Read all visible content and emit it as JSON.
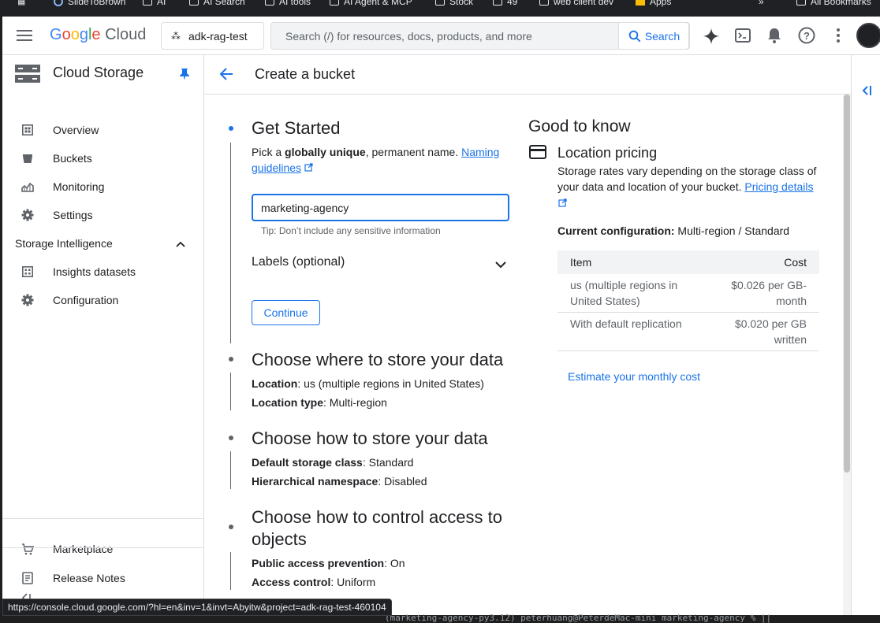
{
  "bookmarks": [
    "SlideToBrown",
    "AI",
    "AI Search",
    "AI tools",
    "AI Agent & MCP",
    "Stock",
    "49",
    "web client dev",
    "Apps",
    "All Bookmarks"
  ],
  "header": {
    "logo_google": "Google",
    "logo_cloud": "Cloud",
    "project": "adk-rag-test",
    "search_placeholder": "Search (/) for resources, docs, products, and more",
    "search_button": "Search"
  },
  "sidebar": {
    "title": "Cloud Storage",
    "items": [
      {
        "label": "Overview",
        "icon": "dashboard-icon"
      },
      {
        "label": "Buckets",
        "icon": "bucket-icon"
      },
      {
        "label": "Monitoring",
        "icon": "monitoring-icon"
      },
      {
        "label": "Settings",
        "icon": "gear-icon"
      }
    ],
    "section": "Storage Intelligence",
    "section_items": [
      {
        "label": "Insights datasets",
        "icon": "dataset-icon"
      },
      {
        "label": "Configuration",
        "icon": "gear-icon"
      }
    ],
    "footer_items": [
      {
        "label": "Marketplace",
        "icon": "cart-icon"
      },
      {
        "label": "Release Notes",
        "icon": "notes-icon"
      }
    ]
  },
  "page": {
    "title": "Create a bucket"
  },
  "steps": {
    "get_started": {
      "title": "Get Started",
      "desc_pre": "Pick a ",
      "desc_bold": "globally unique",
      "desc_post": ", permanent name. ",
      "link1": "Naming",
      "link2": "guidelines",
      "input_value": "marketing-agency",
      "tip": "Tip: Don’t include any sensitive information",
      "labels": "Labels (optional)",
      "continue": "Continue"
    },
    "where": {
      "title": "Choose where to store your data",
      "l1_key": "Location",
      "l1_val": ": us (multiple regions in United States)",
      "l2_key": "Location type",
      "l2_val": ": Multi-region"
    },
    "how": {
      "title": "Choose how to store your data",
      "l1_key": "Default storage class",
      "l1_val": ": Standard",
      "l2_key": "Hierarchical namespace",
      "l2_val": ": Disabled"
    },
    "access": {
      "title_1": "Choose how to control access to",
      "title_2": "objects",
      "l1_key": "Public access prevention",
      "l1_val": ": On",
      "l2_key": "Access control",
      "l2_val": ": Uniform"
    }
  },
  "info": {
    "heading": "Good to know",
    "pricing_title": "Location pricing",
    "pricing_desc_1": "Storage rates vary depending on the storage class of",
    "pricing_desc_2": "your data and location of your bucket.",
    "pricing_link": "Pricing details",
    "config_key": "Current configuration:",
    "config_val": " Multi-region / Standard",
    "table": {
      "col_item": "Item",
      "col_cost": "Cost",
      "rows": [
        {
          "item_1": "us (multiple regions in",
          "item_2": "United States)",
          "cost_1": "$0.026 per GB-",
          "cost_2": "month"
        },
        {
          "item_1": "With default replication",
          "item_2": "",
          "cost_1": "$0.020 per GB",
          "cost_2": "written"
        }
      ]
    },
    "estimate_link": "Estimate your monthly cost"
  },
  "status_url": "https://console.cloud.google.com/?hl=en&inv=1&invt=Abyitw&project=adk-rag-test-460104",
  "terminal_text": "(marketing-agency-py3.12) peterhuang@PeterdeMac-mini marketing-agency % ||",
  "colors": {
    "accent": "#1a73e8",
    "text": "#202124",
    "muted": "#5f6368",
    "border": "#dadce0"
  }
}
